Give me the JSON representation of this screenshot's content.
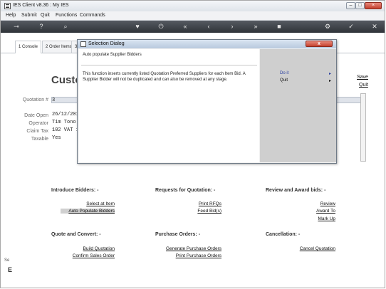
{
  "window": {
    "title": "IES Client v8.36 : My IES"
  },
  "menu": [
    "Help",
    "Submit",
    "Quit",
    "Functions",
    "Commands"
  ],
  "toolbar_icons": [
    "key-icon",
    "help-icon",
    "search-icon",
    "heart-icon",
    "power-icon",
    "rewind-icon",
    "back-icon",
    "play-icon",
    "forward-icon",
    "stop-icon",
    "gear-icon",
    "check-icon",
    "close-icon"
  ],
  "tabs": [
    "1 Console",
    "2 Order Items",
    "3"
  ],
  "page": {
    "title": "Custo",
    "right_links": [
      "Save",
      "Quit"
    ]
  },
  "fields": [
    {
      "label": "Quotation #",
      "value": "3"
    },
    {
      "label": "Date Open",
      "value": "26/12/2013"
    },
    {
      "label": "Operator",
      "value": "Tim Tono"
    },
    {
      "label": "Claim Tax",
      "value": "102 VAT 15"
    },
    {
      "label": "Taxable",
      "value": "Yes"
    }
  ],
  "sections": {
    "introduce": {
      "title": "Introduce Bidders: -",
      "links": [
        "Select at Item",
        "Auto Populate Bidders"
      ]
    },
    "requests": {
      "title": "Requests for Quotation: -",
      "links": [
        "Print RFQs",
        "Feed Bid(s)"
      ]
    },
    "review": {
      "title": "Review and Award bids: -",
      "links": [
        "Review",
        "Award To",
        "Mark Up"
      ]
    },
    "quote": {
      "title": "Quote and Convert: -",
      "links": [
        "Build Quotation",
        "Confirm Sales Order"
      ]
    },
    "purchase": {
      "title": "Purchase Orders: -",
      "links": [
        "Generate Purchase Orders",
        "Print Purchase Orders"
      ]
    },
    "cancel": {
      "title": "Cancellation: -",
      "links": [
        "Cancel Quotation"
      ]
    }
  },
  "side_fragments": [
    "Se",
    "E"
  ],
  "dialog": {
    "title": "Selection Dialog",
    "close": "x",
    "heading": "Auto populate Supplier Bidders",
    "description": "This function inserts currently listed Quotation Preferred Suppliers for each Item Bid. A Supplier Bidder will not be duplicated and can also be removed at any stage.",
    "options": [
      {
        "label": "Do it",
        "arrow": "▸"
      },
      {
        "label": "Quit",
        "arrow": "▸"
      }
    ]
  }
}
